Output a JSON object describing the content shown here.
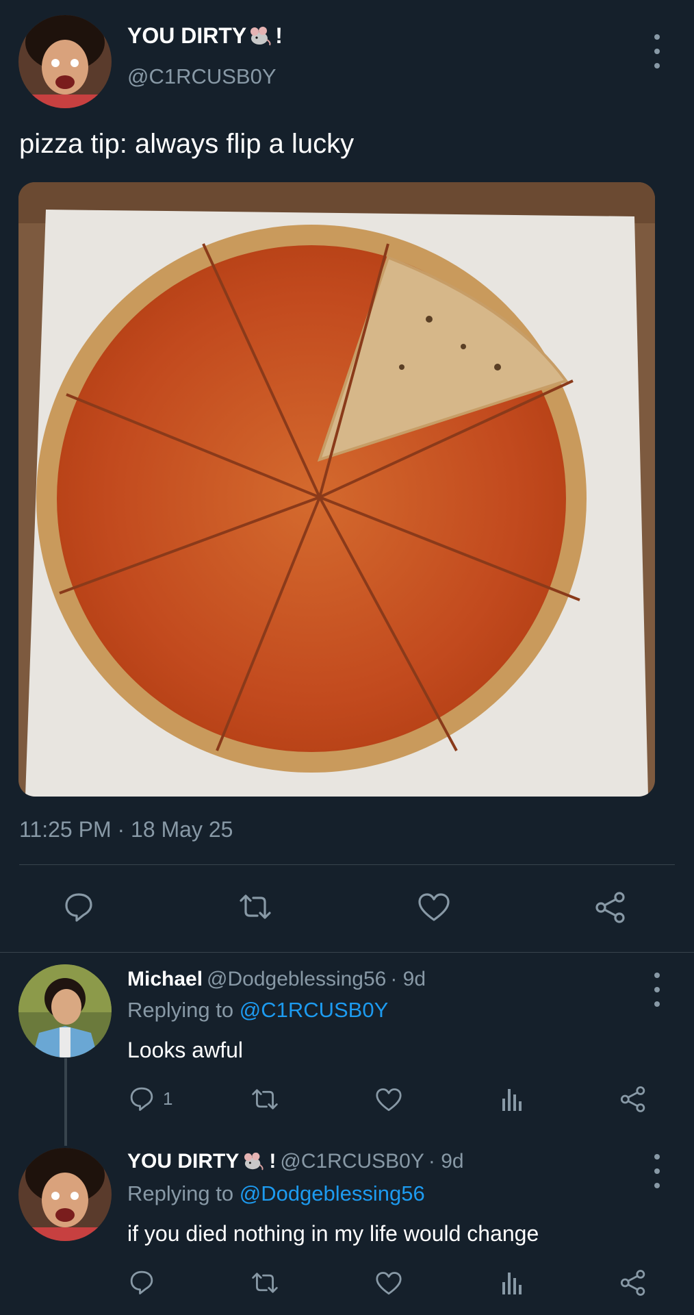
{
  "main_tweet": {
    "author_name": "YOU DIRTY",
    "author_name_suffix": "!",
    "author_emoji": "mouse-emoji",
    "author_handle": "@C1RCUSB0Y",
    "text": "pizza tip: always flip a lucky",
    "timestamp": "11:25 PM · 18 May 25",
    "actions": [
      "reply-icon",
      "retweet-icon",
      "like-icon",
      "share-icon"
    ]
  },
  "replies": [
    {
      "name": "Michael",
      "handle": "@Dodgeblessing56",
      "age": "· 9d",
      "replying_prefix": "Replying to",
      "replying_to": "@C1RCUSB0Y",
      "text": "Looks awful",
      "reply_count": "1"
    },
    {
      "name": "YOU DIRTY",
      "name_suffix": "!",
      "handle": "@C1RCUSB0Y",
      "age": "· 9d",
      "replying_prefix": "Replying to",
      "replying_to": "@Dodgeblessing56",
      "text": "if you died nothing in my life would change"
    }
  ],
  "colors": {
    "background": "#15202b",
    "secondary_text": "#8899a6",
    "link": "#1d9bf0",
    "divider": "#38444d"
  }
}
